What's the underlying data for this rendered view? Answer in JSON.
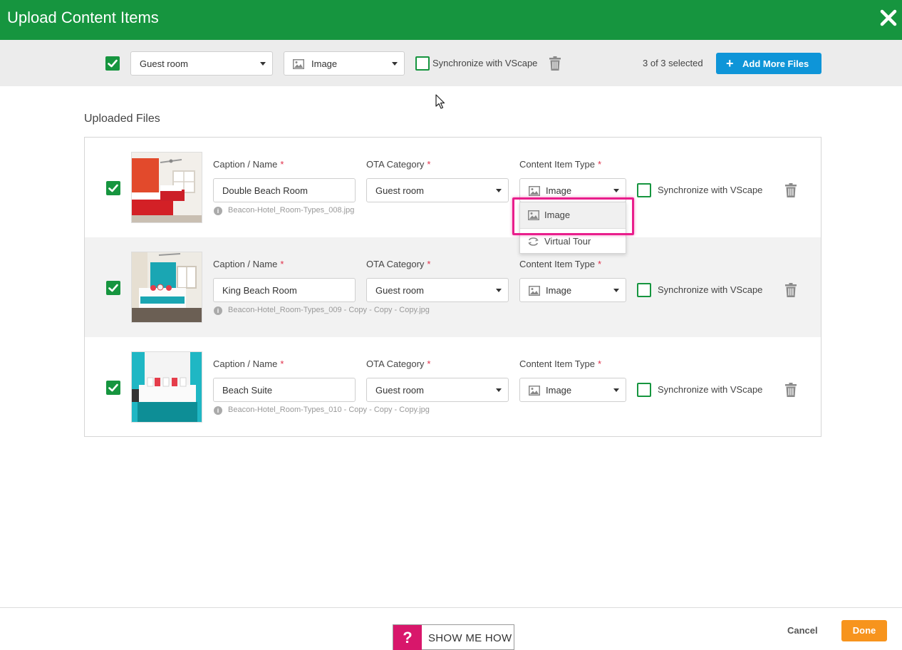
{
  "header": {
    "title": "Upload Content Items"
  },
  "toolbar": {
    "ota_category": "Guest room",
    "content_type": "Image",
    "sync_label": "Synchronize with VScape",
    "selected_text": "3 of 3 selected",
    "add_button": "Add More Files",
    "add_icon": "+"
  },
  "section": {
    "title": "Uploaded Files"
  },
  "labels": {
    "caption": "Caption / Name",
    "ota": "OTA Category",
    "type": "Content Item Type",
    "required": "*",
    "sync": "Synchronize with VScape"
  },
  "files": [
    {
      "caption": "Double Beach Room",
      "ota": "Guest room",
      "type": "Image",
      "filename": "Beacon-Hotel_Room-Types_008.jpg"
    },
    {
      "caption": "King Beach Room",
      "ota": "Guest room",
      "type": "Image",
      "filename": "Beacon-Hotel_Room-Types_009 - Copy - Copy - Copy.jpg"
    },
    {
      "caption": "Beach Suite",
      "ota": "Guest room",
      "type": "Image",
      "filename": "Beacon-Hotel_Room-Types_010 - Copy - Copy - Copy.jpg"
    }
  ],
  "dropdown": {
    "options": [
      "Image",
      "Virtual Tour"
    ]
  },
  "footer": {
    "help_icon": "?",
    "help_label": "SHOW ME HOW",
    "cancel": "Cancel",
    "done": "Done"
  },
  "colors": {
    "brand_green": "#16953f",
    "accent_blue": "#0e95d8",
    "done_orange": "#f7941d",
    "help_pink": "#d8176b",
    "highlight": "#e91e8c"
  }
}
